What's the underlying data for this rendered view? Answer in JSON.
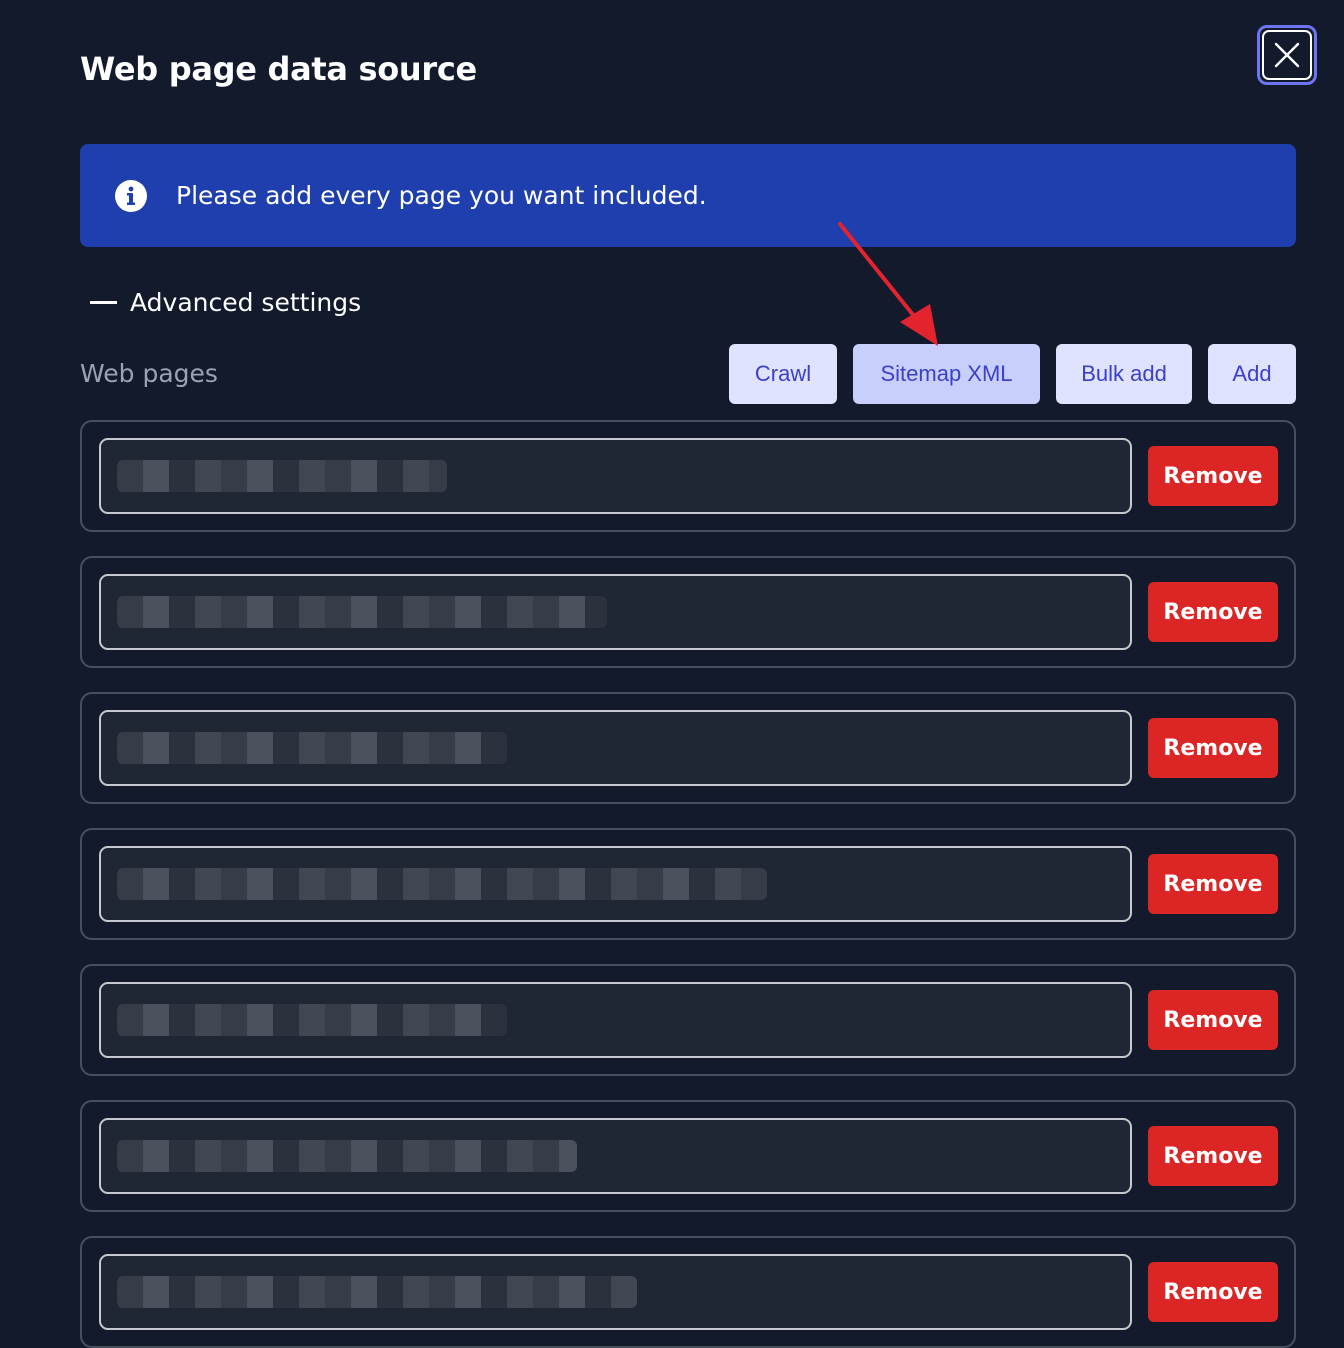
{
  "modal": {
    "title": "Web page data source",
    "close_icon": "close-icon"
  },
  "banner": {
    "icon": "info-icon",
    "text": "Please add every page you want included."
  },
  "advanced_settings": {
    "label": "Advanced settings",
    "icon": "minus-icon"
  },
  "web_pages": {
    "label": "Web pages",
    "buttons": {
      "crawl": "Crawl",
      "sitemap": "Sitemap XML",
      "bulk_add": "Bulk add",
      "add": "Add"
    },
    "rows": [
      {
        "remove": "Remove"
      },
      {
        "remove": "Remove"
      },
      {
        "remove": "Remove"
      },
      {
        "remove": "Remove"
      },
      {
        "remove": "Remove"
      },
      {
        "remove": "Remove"
      },
      {
        "remove": "Remove"
      }
    ]
  },
  "colors": {
    "background": "#121a2c",
    "banner": "#1e3fad",
    "remove": "#dc2626",
    "toolbar_button": "#dfe3ff",
    "annotation_arrow": "#e3232e"
  }
}
